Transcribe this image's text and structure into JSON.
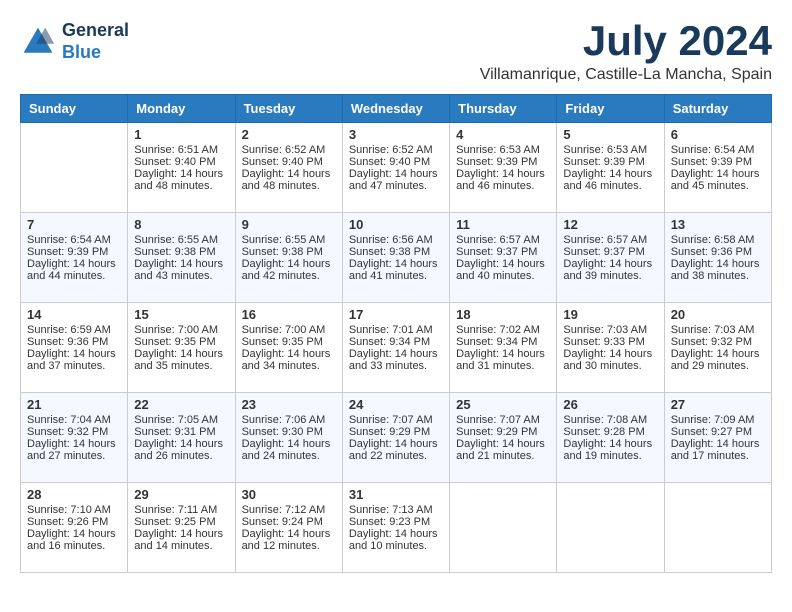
{
  "header": {
    "logo_line1": "General",
    "logo_line2": "Blue",
    "month_year": "July 2024",
    "location": "Villamanrique, Castille-La Mancha, Spain"
  },
  "weekdays": [
    "Sunday",
    "Monday",
    "Tuesday",
    "Wednesday",
    "Thursday",
    "Friday",
    "Saturday"
  ],
  "weeks": [
    [
      {
        "day": "",
        "content": ""
      },
      {
        "day": "1",
        "content": "Sunrise: 6:51 AM\nSunset: 9:40 PM\nDaylight: 14 hours\nand 48 minutes."
      },
      {
        "day": "2",
        "content": "Sunrise: 6:52 AM\nSunset: 9:40 PM\nDaylight: 14 hours\nand 48 minutes."
      },
      {
        "day": "3",
        "content": "Sunrise: 6:52 AM\nSunset: 9:40 PM\nDaylight: 14 hours\nand 47 minutes."
      },
      {
        "day": "4",
        "content": "Sunrise: 6:53 AM\nSunset: 9:39 PM\nDaylight: 14 hours\nand 46 minutes."
      },
      {
        "day": "5",
        "content": "Sunrise: 6:53 AM\nSunset: 9:39 PM\nDaylight: 14 hours\nand 46 minutes."
      },
      {
        "day": "6",
        "content": "Sunrise: 6:54 AM\nSunset: 9:39 PM\nDaylight: 14 hours\nand 45 minutes."
      }
    ],
    [
      {
        "day": "7",
        "content": "Sunrise: 6:54 AM\nSunset: 9:39 PM\nDaylight: 14 hours\nand 44 minutes."
      },
      {
        "day": "8",
        "content": "Sunrise: 6:55 AM\nSunset: 9:38 PM\nDaylight: 14 hours\nand 43 minutes."
      },
      {
        "day": "9",
        "content": "Sunrise: 6:55 AM\nSunset: 9:38 PM\nDaylight: 14 hours\nand 42 minutes."
      },
      {
        "day": "10",
        "content": "Sunrise: 6:56 AM\nSunset: 9:38 PM\nDaylight: 14 hours\nand 41 minutes."
      },
      {
        "day": "11",
        "content": "Sunrise: 6:57 AM\nSunset: 9:37 PM\nDaylight: 14 hours\nand 40 minutes."
      },
      {
        "day": "12",
        "content": "Sunrise: 6:57 AM\nSunset: 9:37 PM\nDaylight: 14 hours\nand 39 minutes."
      },
      {
        "day": "13",
        "content": "Sunrise: 6:58 AM\nSunset: 9:36 PM\nDaylight: 14 hours\nand 38 minutes."
      }
    ],
    [
      {
        "day": "14",
        "content": "Sunrise: 6:59 AM\nSunset: 9:36 PM\nDaylight: 14 hours\nand 37 minutes."
      },
      {
        "day": "15",
        "content": "Sunrise: 7:00 AM\nSunset: 9:35 PM\nDaylight: 14 hours\nand 35 minutes."
      },
      {
        "day": "16",
        "content": "Sunrise: 7:00 AM\nSunset: 9:35 PM\nDaylight: 14 hours\nand 34 minutes."
      },
      {
        "day": "17",
        "content": "Sunrise: 7:01 AM\nSunset: 9:34 PM\nDaylight: 14 hours\nand 33 minutes."
      },
      {
        "day": "18",
        "content": "Sunrise: 7:02 AM\nSunset: 9:34 PM\nDaylight: 14 hours\nand 31 minutes."
      },
      {
        "day": "19",
        "content": "Sunrise: 7:03 AM\nSunset: 9:33 PM\nDaylight: 14 hours\nand 30 minutes."
      },
      {
        "day": "20",
        "content": "Sunrise: 7:03 AM\nSunset: 9:32 PM\nDaylight: 14 hours\nand 29 minutes."
      }
    ],
    [
      {
        "day": "21",
        "content": "Sunrise: 7:04 AM\nSunset: 9:32 PM\nDaylight: 14 hours\nand 27 minutes."
      },
      {
        "day": "22",
        "content": "Sunrise: 7:05 AM\nSunset: 9:31 PM\nDaylight: 14 hours\nand 26 minutes."
      },
      {
        "day": "23",
        "content": "Sunrise: 7:06 AM\nSunset: 9:30 PM\nDaylight: 14 hours\nand 24 minutes."
      },
      {
        "day": "24",
        "content": "Sunrise: 7:07 AM\nSunset: 9:29 PM\nDaylight: 14 hours\nand 22 minutes."
      },
      {
        "day": "25",
        "content": "Sunrise: 7:07 AM\nSunset: 9:29 PM\nDaylight: 14 hours\nand 21 minutes."
      },
      {
        "day": "26",
        "content": "Sunrise: 7:08 AM\nSunset: 9:28 PM\nDaylight: 14 hours\nand 19 minutes."
      },
      {
        "day": "27",
        "content": "Sunrise: 7:09 AM\nSunset: 9:27 PM\nDaylight: 14 hours\nand 17 minutes."
      }
    ],
    [
      {
        "day": "28",
        "content": "Sunrise: 7:10 AM\nSunset: 9:26 PM\nDaylight: 14 hours\nand 16 minutes."
      },
      {
        "day": "29",
        "content": "Sunrise: 7:11 AM\nSunset: 9:25 PM\nDaylight: 14 hours\nand 14 minutes."
      },
      {
        "day": "30",
        "content": "Sunrise: 7:12 AM\nSunset: 9:24 PM\nDaylight: 14 hours\nand 12 minutes."
      },
      {
        "day": "31",
        "content": "Sunrise: 7:13 AM\nSunset: 9:23 PM\nDaylight: 14 hours\nand 10 minutes."
      },
      {
        "day": "",
        "content": ""
      },
      {
        "day": "",
        "content": ""
      },
      {
        "day": "",
        "content": ""
      }
    ]
  ]
}
